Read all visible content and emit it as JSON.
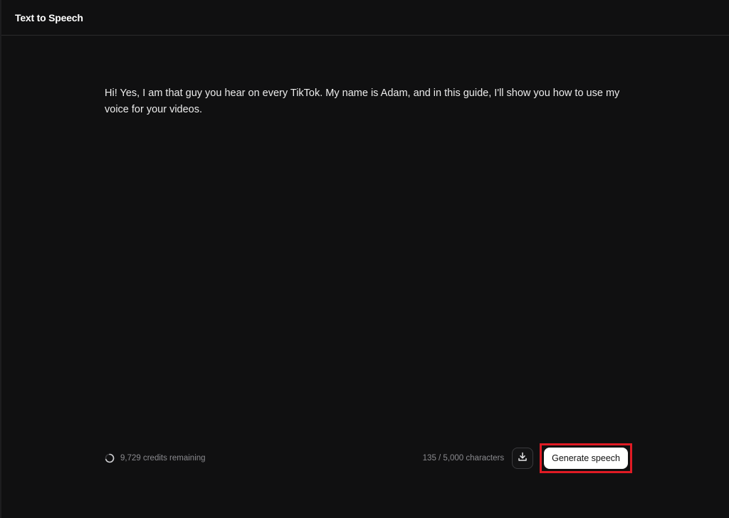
{
  "header": {
    "title": "Text to Speech"
  },
  "editor": {
    "text": "Hi! Yes, I am that guy you hear on every TikTok. My name is Adam, and in this guide, I'll show you how to use my voice for your videos."
  },
  "footer": {
    "credits_text": "9,729 credits remaining",
    "char_count_text": "135 / 5,000 characters",
    "generate_label": "Generate speech",
    "icons": {
      "credits": "spinner-icon",
      "download": "download-icon"
    }
  },
  "colors": {
    "background": "#101011",
    "text": "#ececec",
    "muted": "#8a8a8e",
    "highlight": "#e01b24",
    "button_bg": "#ffffff"
  }
}
